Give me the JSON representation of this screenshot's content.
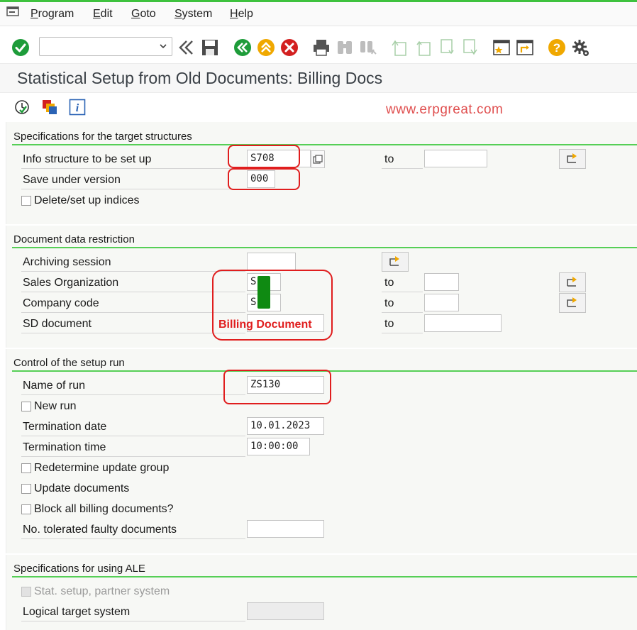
{
  "menu": {
    "items": [
      "Program",
      "Edit",
      "Goto",
      "System",
      "Help"
    ]
  },
  "toolbar": {
    "command_field_value": ""
  },
  "title": "Statistical Setup from Old Documents: Billing Docs",
  "watermark": "www.erpgreat.com",
  "annotation": "Billing Document",
  "groups": {
    "target": {
      "title": "Specifications for the target structures",
      "info_structure_label": "Info structure to be set up",
      "info_structure_value": "S708",
      "info_structure_to_label": "to",
      "info_structure_to_value": "",
      "version_label": "Save under version",
      "version_value": "000",
      "delete_indices_label": "Delete/set up indices"
    },
    "restriction": {
      "title": "Document data restriction",
      "archiving_label": "Archiving session",
      "archiving_value": "",
      "sales_org_label": "Sales Organization",
      "sales_org_value": "S   0",
      "sales_org_to_label": "to",
      "company_code_label": "Company code",
      "company_code_value": "S   0",
      "company_code_to_label": "to",
      "sd_document_label": "SD document",
      "sd_document_to_label": "to"
    },
    "control": {
      "title": "Control of the setup run",
      "run_name_label": "Name of run",
      "run_name_value": "ZS130",
      "new_run_label": "New run",
      "term_date_label": "Termination date",
      "term_date_value": "10.01.2023",
      "term_time_label": "Termination time",
      "term_time_value": "10:00:00",
      "redetermine_label": "Redetermine update group",
      "update_docs_label": "Update documents",
      "block_label": "Block all billing documents?",
      "tolerated_label": "No. tolerated faulty documents",
      "tolerated_value": ""
    },
    "ale": {
      "title": "Specifications for using ALE",
      "partner_label": "Stat. setup, partner system",
      "logical_label": "Logical target system",
      "logical_value": ""
    }
  },
  "colors": {
    "accent_green": "#56cf56",
    "annotation_red": "#e01e1e",
    "watermark_red": "#e05050"
  }
}
